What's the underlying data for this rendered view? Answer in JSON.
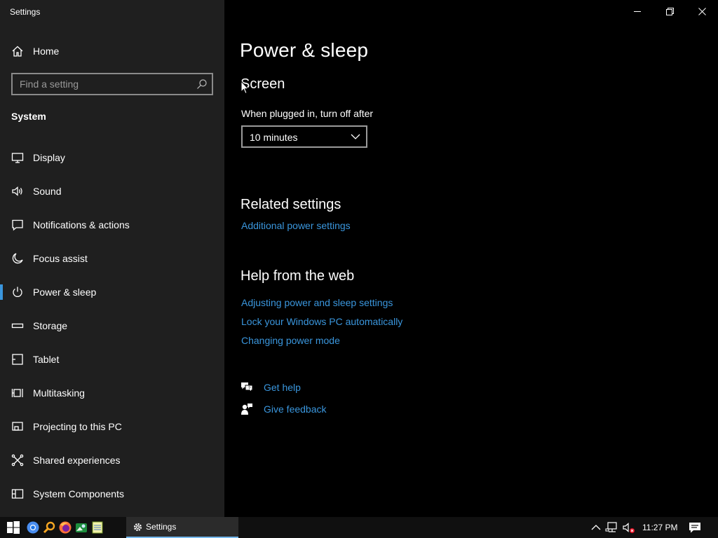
{
  "window": {
    "title": "Settings"
  },
  "sidebar": {
    "home_label": "Home",
    "search_placeholder": "Find a setting",
    "section_label": "System",
    "items": [
      {
        "label": "Display",
        "icon": "monitor-icon"
      },
      {
        "label": "Sound",
        "icon": "speaker-icon"
      },
      {
        "label": "Notifications & actions",
        "icon": "notifications-icon"
      },
      {
        "label": "Focus assist",
        "icon": "moon-icon"
      },
      {
        "label": "Power & sleep",
        "icon": "power-icon",
        "active": true
      },
      {
        "label": "Storage",
        "icon": "storage-icon"
      },
      {
        "label": "Tablet",
        "icon": "tablet-icon"
      },
      {
        "label": "Multitasking",
        "icon": "multitasking-icon"
      },
      {
        "label": "Projecting to this PC",
        "icon": "projector-icon"
      },
      {
        "label": "Shared experiences",
        "icon": "shared-experiences-icon"
      },
      {
        "label": "System Components",
        "icon": "system-components-icon"
      }
    ]
  },
  "main": {
    "title": "Power & sleep",
    "screen_heading": "Screen",
    "plugged_in_label": "When plugged in, turn off after",
    "plugged_in_value": "10 minutes",
    "related_heading": "Related settings",
    "related_link": "Additional power settings",
    "help_heading": "Help from the web",
    "help_links": [
      "Adjusting power and sleep settings",
      "Lock your Windows PC automatically",
      "Changing power mode"
    ],
    "get_help": "Get help",
    "give_feedback": "Give feedback"
  },
  "taskbar": {
    "settings_label": "Settings",
    "clock": "11:27 PM"
  },
  "colors": {
    "sidebar_bg": "#1f1f1f",
    "main_bg": "#000000",
    "accent_link": "#3a96dd",
    "taskbar_bg": "#101010"
  }
}
